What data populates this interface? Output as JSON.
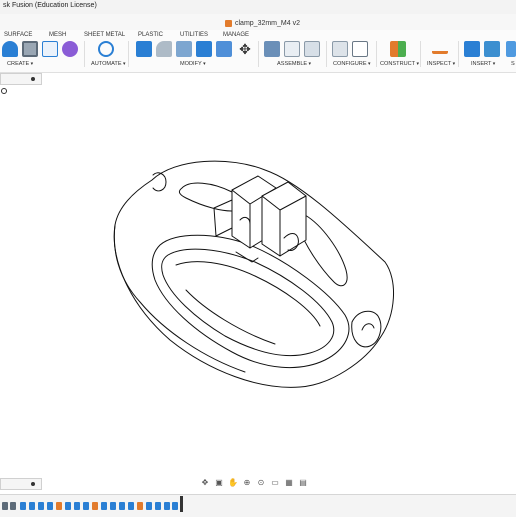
{
  "window": {
    "title": "sk Fusion (Education License)"
  },
  "document_tab": {
    "name": "clamp_32mm_M4 v2"
  },
  "menu_tabs": [
    "SURFACE",
    "MESH",
    "SHEET METAL",
    "PLASTIC",
    "UTILITIES",
    "MANAGE"
  ],
  "tool_groups": [
    "CREATE",
    "AUTOMATE",
    "MODIFY",
    "ASSEMBLE",
    "CONFIGURE",
    "CONSTRUCT",
    "INSPECT",
    "INSERT",
    "S"
  ],
  "colors": {
    "accent": "#2a7fd4",
    "orange": "#e27b2c",
    "purple": "#8a5cd6",
    "green": "#4cae4f"
  },
  "icons": [
    "sketch-icon",
    "box-icon",
    "form-icon",
    "automate-icon",
    "press-pull-icon",
    "fillet-icon",
    "shell-icon",
    "combine-icon",
    "move-icon",
    "joint-icon",
    "configure-icon",
    "plane-icon",
    "measure-icon",
    "insert-icon",
    "decal-icon"
  ]
}
